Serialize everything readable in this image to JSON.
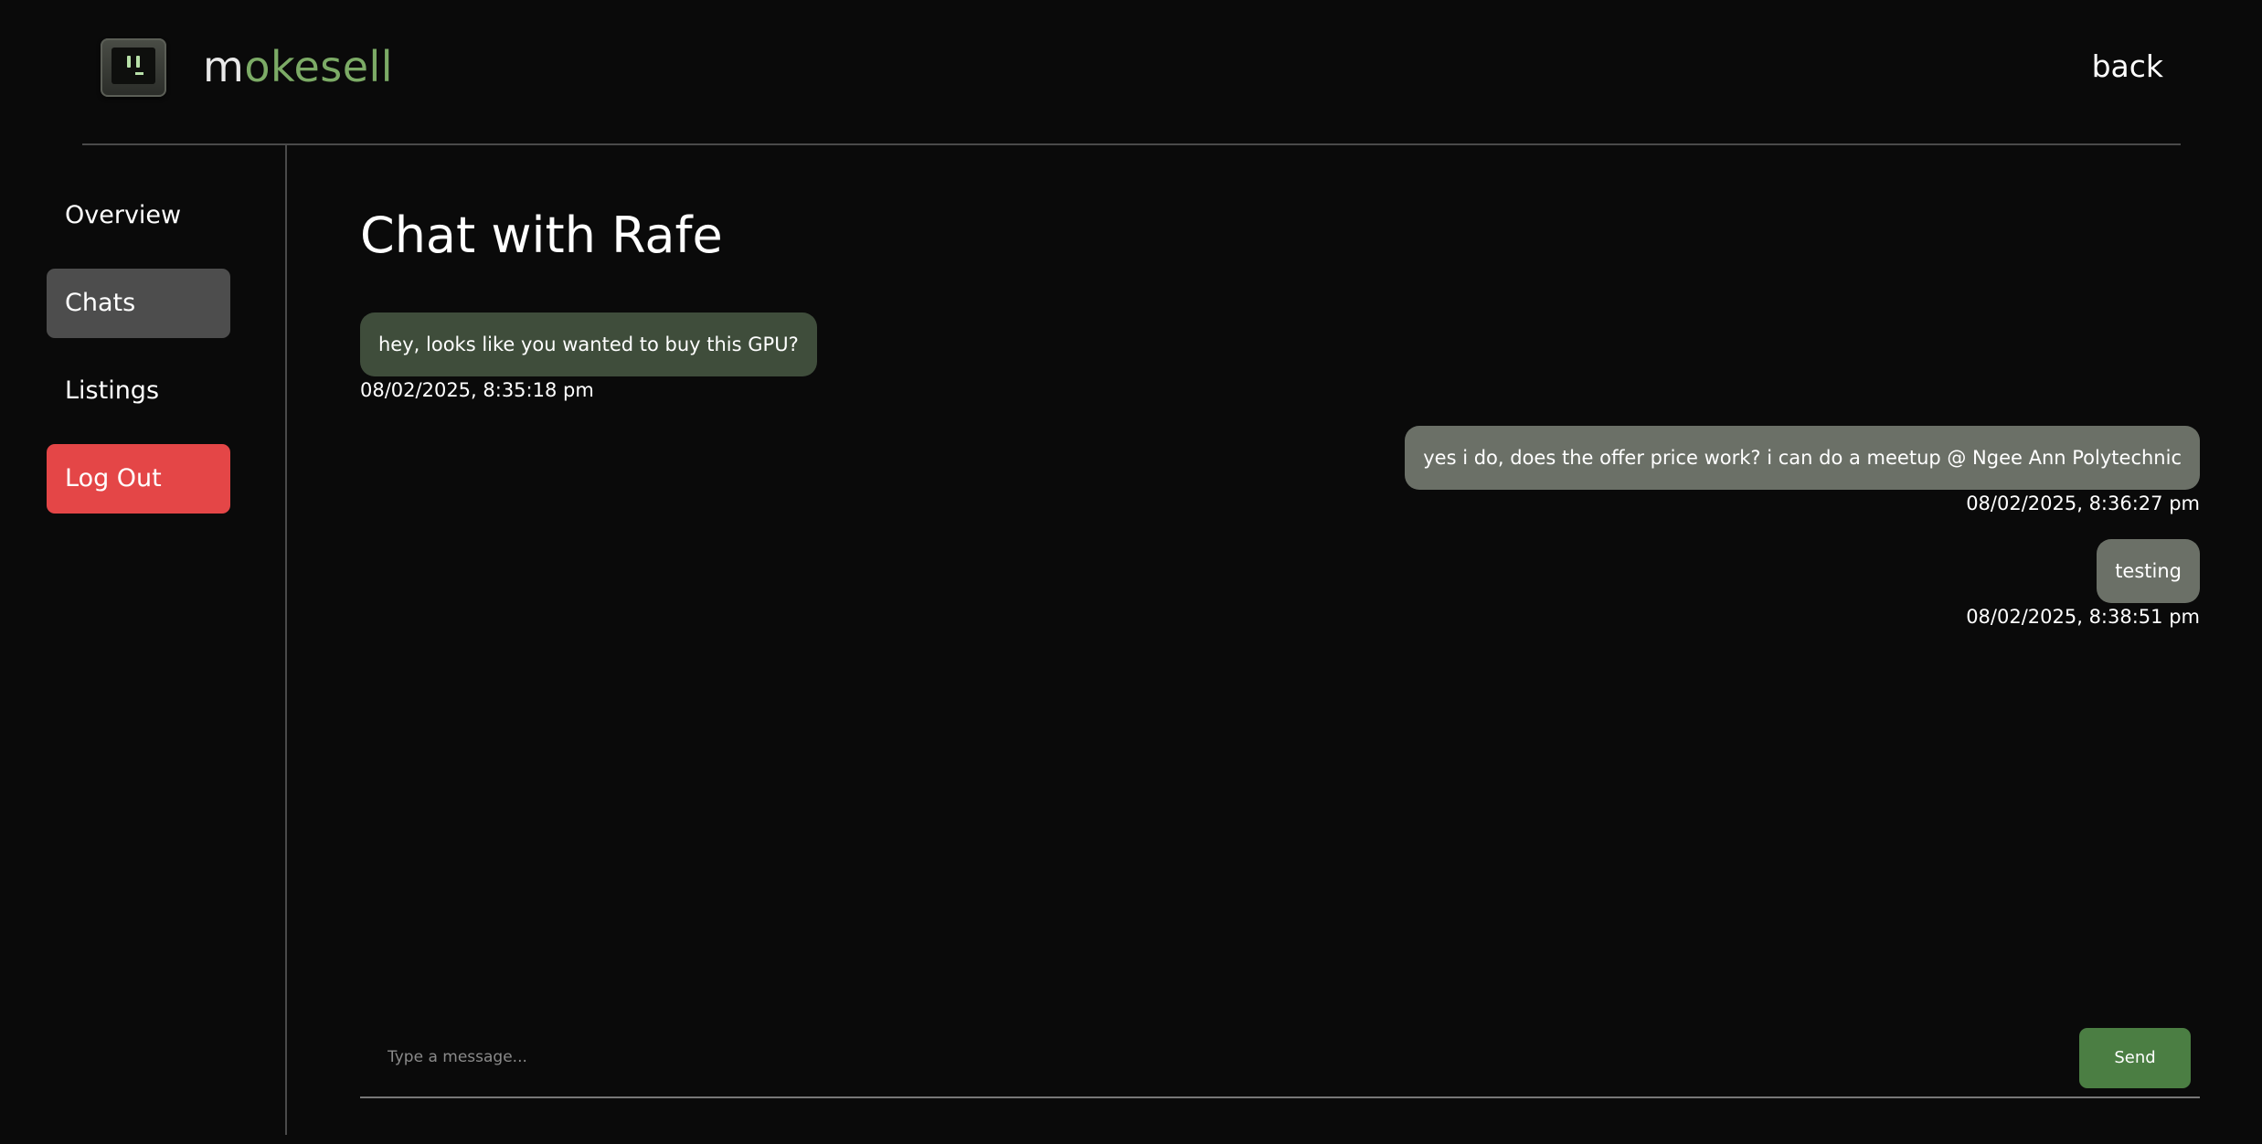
{
  "app": {
    "brand_part1": "m",
    "brand_part2": "okesell",
    "logo_icon": "monitor-face-icon",
    "accent_color": "#7cab66"
  },
  "header": {
    "back_label": "back"
  },
  "sidebar": {
    "items": [
      {
        "label": "Overview",
        "active": false
      },
      {
        "label": "Chats",
        "active": true
      },
      {
        "label": "Listings",
        "active": false
      },
      {
        "label": "Log Out",
        "active": false,
        "color": "#e44647"
      }
    ]
  },
  "chat": {
    "title": "Chat with Rafe",
    "messages": [
      {
        "direction": "received",
        "text": "hey, looks like you wanted to buy this GPU?",
        "timestamp": "08/02/2025, 8:35:18 pm"
      },
      {
        "direction": "sent",
        "text": "yes i do, does the offer price work? i can do a meetup @ Ngee Ann Polytechnic",
        "timestamp": "08/02/2025, 8:36:27 pm"
      },
      {
        "direction": "sent",
        "text": "testing",
        "timestamp": "08/02/2025, 8:38:51 pm"
      }
    ]
  },
  "composer": {
    "placeholder": "Type a message...",
    "value": "",
    "send_label": "Send",
    "send_color": "#4b7e43"
  }
}
